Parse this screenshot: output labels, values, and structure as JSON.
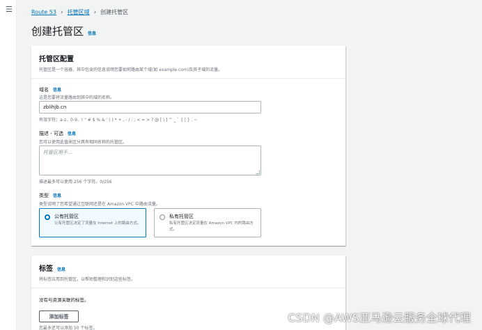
{
  "nav": {
    "menu_icon": "menu-icon"
  },
  "breadcrumb": {
    "root": "Route 53",
    "parent": "托管区域",
    "current": "创建托管区"
  },
  "page": {
    "title": "创建托管区",
    "info": "信息"
  },
  "config": {
    "title": "托管区配置",
    "description": "托管区是一个容器，其中包含的信息说明您要如何路由某个域(如 example.com)及其子域的流量。",
    "domain": {
      "label": "域名",
      "info": "信息",
      "description": "这是您要将流量路由到其中的域的名称。",
      "value": "zblihjb.cn",
      "constraint": "有效字符：a-z、0-9、! \" # $ % & ' ( ) * + , - / : ; < = > ? @ [ \\ ] ^ _ ` { | } . ~"
    },
    "desc_field": {
      "label": "描述 - 可选",
      "info": "信息",
      "description": "您可以使用此值来区分具有相同名称的托管区。",
      "placeholder": "托管区用于...",
      "constraint": "描述最多可以使用 256 个字符。0/256"
    },
    "type": {
      "label": "类型",
      "info": "信息",
      "description": "类型说明了您希望通过互联网还是在 Amazon VPC 中路由流量。",
      "options": [
        {
          "title": "公有托管区",
          "description": "公有托管区决定了流量在 Internet 上的路由方式。",
          "selected": true
        },
        {
          "title": "私有托管区",
          "description": "私有托管区决定流量在 Amazon VPC 内的路由方式。",
          "selected": false
        }
      ]
    }
  },
  "tags": {
    "title": "标签",
    "info": "信息",
    "description": "将标签应用到托管区，以帮助整理和识别这些标签。",
    "empty_text": "没有与资源关联的标签。",
    "add_button": "添加标签",
    "limit_text": "您最多还可以添加 50 个标签。"
  },
  "watermark": "CSDN @AWS亚马逊云服务全球代理",
  "colors": {
    "link": "#0073bb",
    "selected_border": "#0073bb",
    "selected_bg": "#f1faff"
  }
}
